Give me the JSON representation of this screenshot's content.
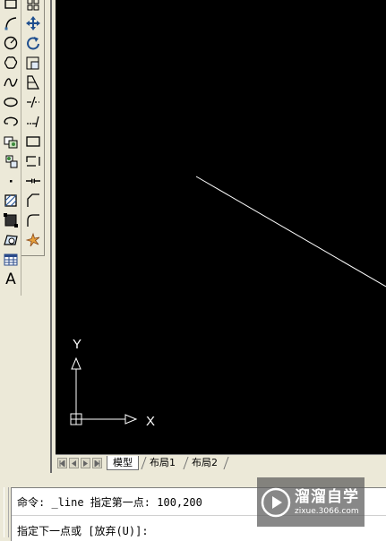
{
  "draw_toolbar": {
    "icons": [
      "polyline-icon",
      "arc-icon",
      "circle-icon",
      "revision-cloud-icon",
      "spline-icon",
      "ellipse-icon",
      "ellipse-arc-icon",
      "insert-block-icon",
      "make-block-icon",
      "point-icon",
      "hatch-icon",
      "gradient-icon",
      "region-icon",
      "table-icon",
      "multiline-text-icon"
    ],
    "text_icon_glyph": "A"
  },
  "modify_toolbar": {
    "icons": [
      "array-icon",
      "move-icon",
      "rotate-icon",
      "scale-icon",
      "stretch-icon",
      "trim-icon",
      "extend-icon",
      "break-at-point-icon",
      "break-icon",
      "join-icon",
      "chamfer-icon",
      "fillet-icon",
      "explode-icon"
    ]
  },
  "canvas": {
    "background": "#000000",
    "line_color": "#ffffff",
    "ucs": {
      "x_label": "X",
      "y_label": "Y"
    }
  },
  "tabs": {
    "items": [
      {
        "label": "模型",
        "active": true
      },
      {
        "label": "布局1",
        "active": false
      },
      {
        "label": "布局2",
        "active": false
      }
    ]
  },
  "command": {
    "history": "命令: _line 指定第一点: 100,200",
    "prompt": "指定下一点或 [放弃(U)]:"
  },
  "watermark": {
    "title": "溜溜自学",
    "url": "zixue.3066.com"
  }
}
